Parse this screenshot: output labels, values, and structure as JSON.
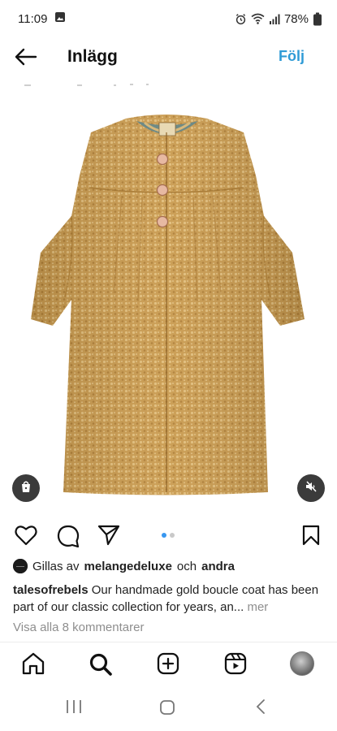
{
  "status_bar": {
    "time": "11:09",
    "battery": "78%",
    "icons": [
      "gallery-notification-icon",
      "alarm-icon",
      "wifi-icon",
      "signal-icon",
      "battery-icon"
    ]
  },
  "header": {
    "back_icon": "arrow-left-icon",
    "title": "Inlägg",
    "follow_label": "Följ",
    "follow_color": "#2f9bd6"
  },
  "post": {
    "image_subject": "gold boucle coat",
    "carousel": {
      "current": 1,
      "total": 2,
      "active_color": "#3897f0"
    },
    "shop_icon": "shopping-bag-icon",
    "mute_icon": "speaker-muted-icon"
  },
  "actions": {
    "like_icon": "heart-icon",
    "comment_icon": "comment-icon",
    "share_icon": "send-icon",
    "save_icon": "bookmark-icon"
  },
  "likes": {
    "prefix": "Gillas av",
    "user": "melangedeluxe",
    "connector": "och",
    "others": "andra"
  },
  "caption": {
    "username": "talesofrebels",
    "text": "Our handmade gold boucle coat has been part of our classic collection for years, an...",
    "more": "mer"
  },
  "comments_link": "Visa alla 8 kommentarer",
  "bottom_nav": {
    "items": [
      "home-icon",
      "search-icon",
      "create-icon",
      "reels-icon",
      "profile-avatar"
    ]
  },
  "system_nav": [
    "recents-button",
    "home-button",
    "back-button"
  ]
}
